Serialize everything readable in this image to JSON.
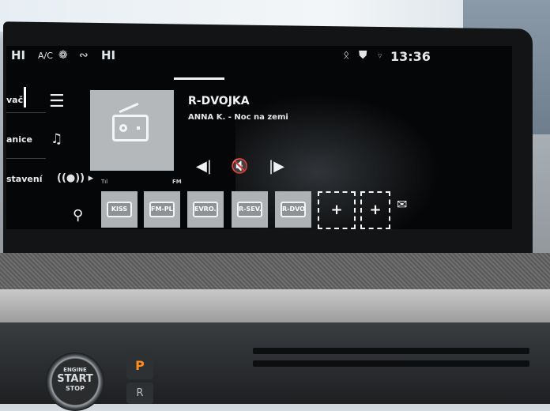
{
  "status_bar": {
    "hi_left": "HI",
    "ac_label": "A/C",
    "fan_icon": "fan-icon",
    "seat_icon": "seat-airflow-icon",
    "hi_right": "HI",
    "bluetooth_icon": "bluetooth-icon",
    "car_icon": "connected-car-icon",
    "time": "13:36"
  },
  "sidebar": {
    "menu_icon": "hamburger-menu-icon",
    "items": [
      {
        "label": "vač"
      },
      {
        "label": "anice"
      },
      {
        "label": "stavení"
      }
    ],
    "music_icon": "music-source-icon",
    "radio_icon": "radio-broadcast-icon",
    "search_icon": "search-icon"
  },
  "now_playing": {
    "station": "R-DVOJKA",
    "rds_text": "ANNA K. - Noc na zemi",
    "band": "FM",
    "signal_label": "Tıl"
  },
  "controls": {
    "prev_icon": "previous-icon",
    "mute_icon": "mute-icon",
    "next_icon": "next-icon"
  },
  "presets": [
    {
      "label": "KISS"
    },
    {
      "label": "FM-PL..."
    },
    {
      "label": "EVRO..."
    },
    {
      "label": "R-SEV..."
    },
    {
      "label": "R-DVO..."
    }
  ],
  "add_preset": {
    "label": "+"
  },
  "add_preset_2": {
    "label": "+"
  },
  "colors": {
    "screen_bg": "#050607",
    "preset_tile": "#aeb2b5",
    "park_accent": "#ff8b1a"
  },
  "console": {
    "start_button": {
      "line1": "ENGINE",
      "line2": "START",
      "line3": "STOP"
    },
    "park_button": {
      "label": "P"
    },
    "reverse_button": {
      "label": "R"
    }
  }
}
